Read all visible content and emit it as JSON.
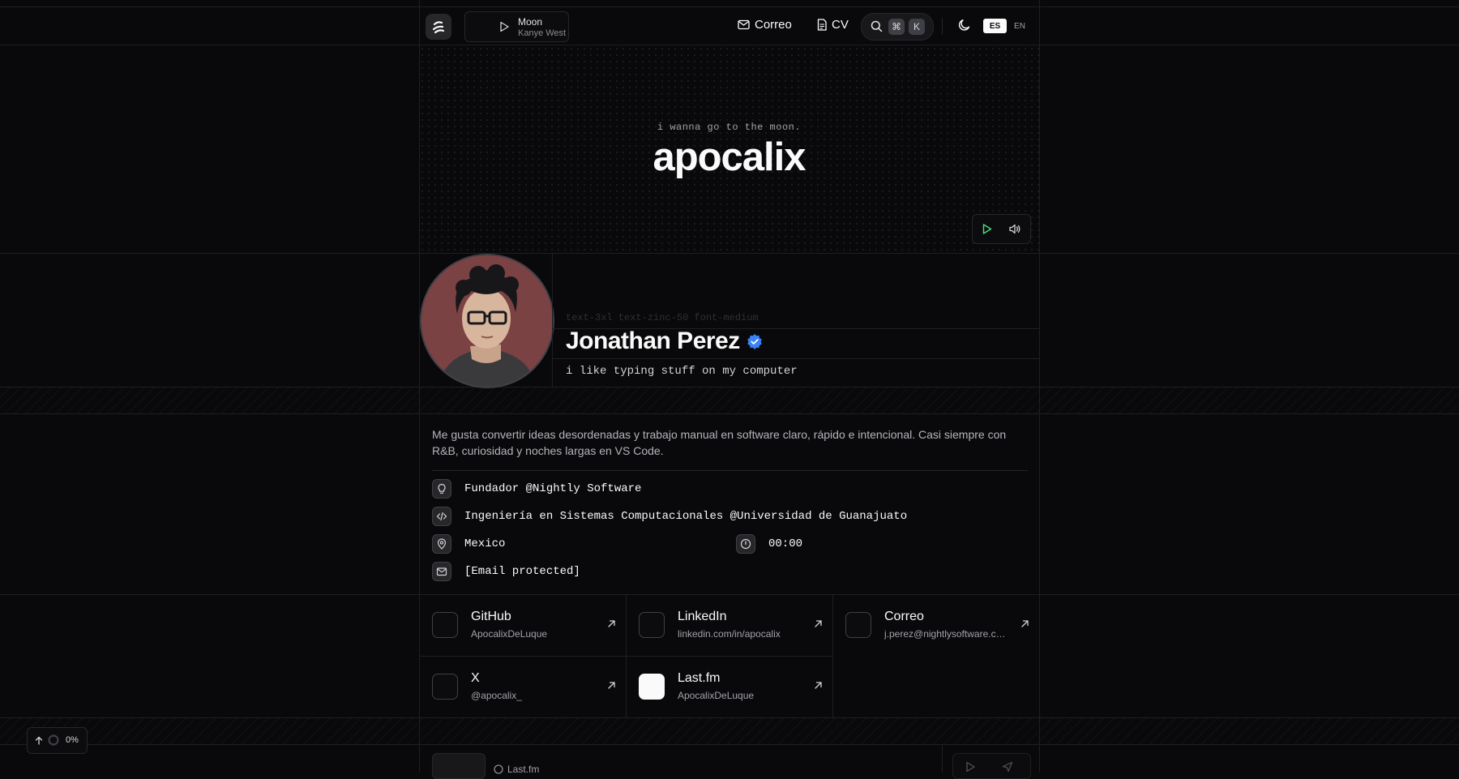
{
  "nav": {
    "now_playing": {
      "track": "Moon",
      "artist": "Kanye West"
    },
    "mail_label": "Correo",
    "cv_label": "CV",
    "search_keys": [
      "⌘",
      "K"
    ],
    "languages": [
      "ES",
      "EN"
    ],
    "active_language": "ES"
  },
  "hero": {
    "tagline": "i wanna go to the moon.",
    "title": "apocalix"
  },
  "profile": {
    "class_hint": "text-3xl text-zinc-50 font-medium",
    "name": "Jonathan Perez",
    "short_bio": "i like typing stuff on my computer",
    "about": "Me gusta convertir ideas desordenadas y trabajo manual en software claro, rápido e intencional. Casi siempre con R&B, curiosidad y noches largas en VS Code.",
    "details": {
      "role": "Fundador @Nightly Software",
      "education": "Ingeniería en Sistemas Computacionales @Universidad de Guanajuato",
      "location": "Mexico",
      "time": "00:00",
      "email": "[Email protected]"
    }
  },
  "social": [
    {
      "title": "GitHub",
      "subtitle": "ApocalixDeLuque"
    },
    {
      "title": "LinkedIn",
      "subtitle": "linkedin.com/in/apocalix"
    },
    {
      "title": "Correo",
      "subtitle": "j.perez@nightlysoftware.com"
    },
    {
      "title": "X",
      "subtitle": "@apocalix_"
    },
    {
      "title": "Last.fm",
      "subtitle": "ApocalixDeLuque"
    }
  ],
  "footer": {
    "scroll_progress": "0%",
    "lastfm_label": "Last.fm"
  },
  "colors": {
    "background": "#09090b",
    "border": "#1f1f23",
    "verified": "#3b82f6",
    "play_green": "#4ade80"
  }
}
